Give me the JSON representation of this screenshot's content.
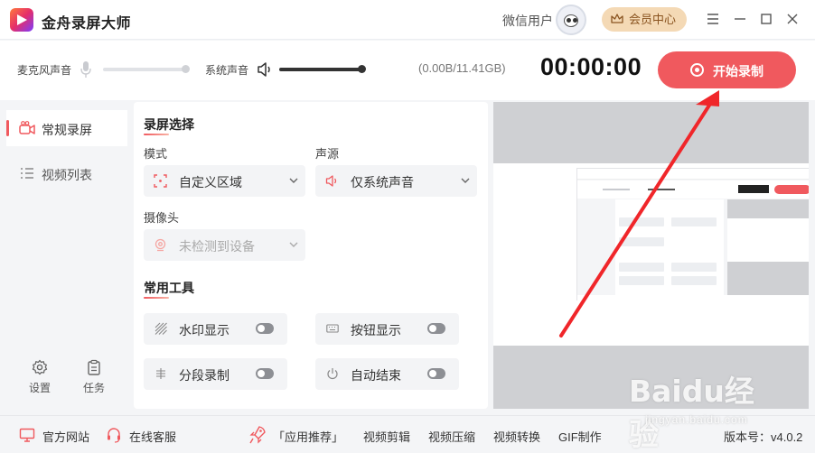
{
  "app": {
    "title": "金舟录屏大师",
    "username": "微信用户",
    "vip_label": "会员中心",
    "version_label": "版本号：v4.0.2"
  },
  "audio": {
    "mic_label": "麦克风声音",
    "system_label": "系统声音",
    "mic_level": 1.0,
    "system_level": 1.0,
    "storage": "(0.00B/11.41GB)"
  },
  "recorder": {
    "timer": "00:00:00",
    "start_label": "开始录制"
  },
  "sidebar": {
    "items": [
      {
        "label": "常规录屏",
        "active": true
      },
      {
        "label": "视频列表",
        "active": false
      }
    ],
    "settings_label": "设置",
    "tasks_label": "任务"
  },
  "panel": {
    "section_title": "录屏选择",
    "mode_label": "模式",
    "mode_value": "自定义区域",
    "source_label": "声源",
    "source_value": "仅系统声音",
    "camera_label": "摄像头",
    "camera_value": "未检测到设备",
    "tools_title": "常用工具",
    "tools": [
      {
        "label": "水印显示",
        "on": false
      },
      {
        "label": "按钮显示",
        "on": false
      },
      {
        "label": "分段录制",
        "on": false
      },
      {
        "label": "自动结束",
        "on": false
      }
    ]
  },
  "footer": {
    "website": "官方网站",
    "support": "在线客服",
    "recommend": "「应用推荐」",
    "links": [
      "视频剪辑",
      "视频压缩",
      "视频转换",
      "GIF制作"
    ]
  },
  "watermark": {
    "brand": "Baidu经验",
    "url": "jingyan.baidu.com"
  },
  "colors": {
    "accent": "#f0595e",
    "vip_bg": "#f4d9b5",
    "vip_text": "#8a5420",
    "toggle_off": "#8d8f94",
    "arrow": "#f0262a"
  },
  "icons": {
    "mic": "microphone-icon",
    "speaker": "speaker-icon",
    "record": "record-icon",
    "settings": "gear-icon",
    "tasks": "clipboard-icon"
  }
}
